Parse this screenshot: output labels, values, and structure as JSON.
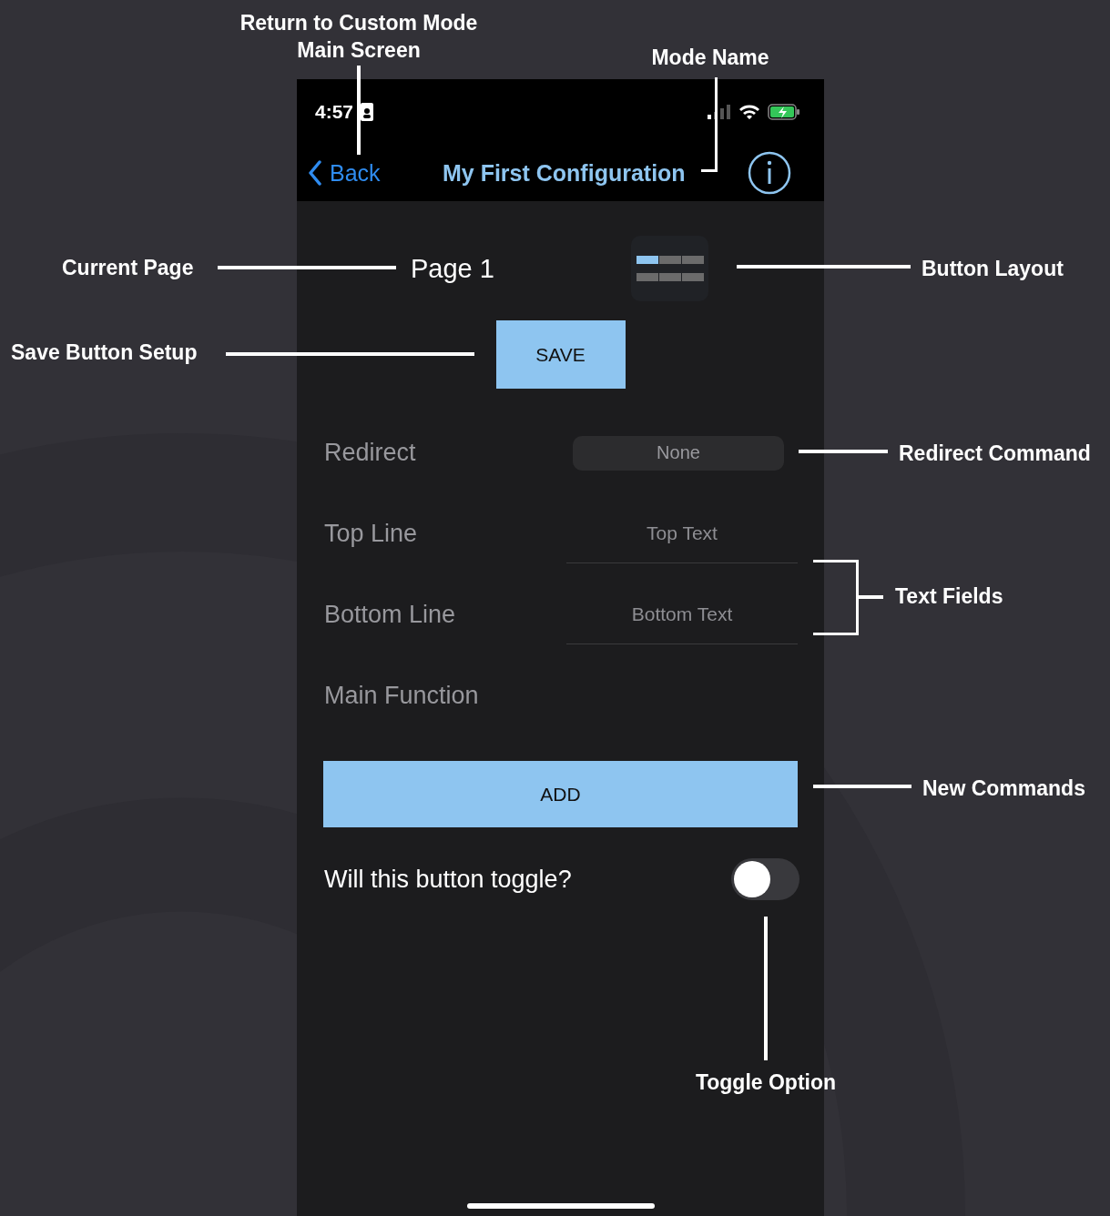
{
  "annotations": [
    {
      "text": "Return to Custom Mode\nMain Screen"
    },
    {
      "text": "Mode Name"
    },
    {
      "text": "Current Page"
    },
    {
      "text": "Button Layout"
    },
    {
      "text": "Save Button Setup"
    },
    {
      "text": "Redirect Command"
    },
    {
      "text": "Text Fields"
    },
    {
      "text": "New Commands"
    },
    {
      "text": "Toggle Option"
    }
  ],
  "status_bar": {
    "time": "4:57"
  },
  "nav": {
    "back": "Back",
    "title": "My First Configuration"
  },
  "page": {
    "label": "Page 1"
  },
  "layout": {
    "cells": [
      {
        "selected": true
      },
      {
        "selected": false
      },
      {
        "selected": false
      },
      {
        "selected": false
      },
      {
        "selected": false
      },
      {
        "selected": false
      }
    ]
  },
  "save_button": "SAVE",
  "rows": [
    {
      "kind": "select",
      "label": "Redirect",
      "value": "None"
    },
    {
      "kind": "text",
      "label": "Top Line",
      "placeholder": "Top Text"
    },
    {
      "kind": "text",
      "label": "Bottom Line",
      "placeholder": "Bottom Text"
    },
    {
      "kind": "label",
      "label": "Main Function"
    }
  ],
  "add_button": "ADD",
  "toggle": {
    "label": "Will this button toggle?",
    "on": false
  }
}
